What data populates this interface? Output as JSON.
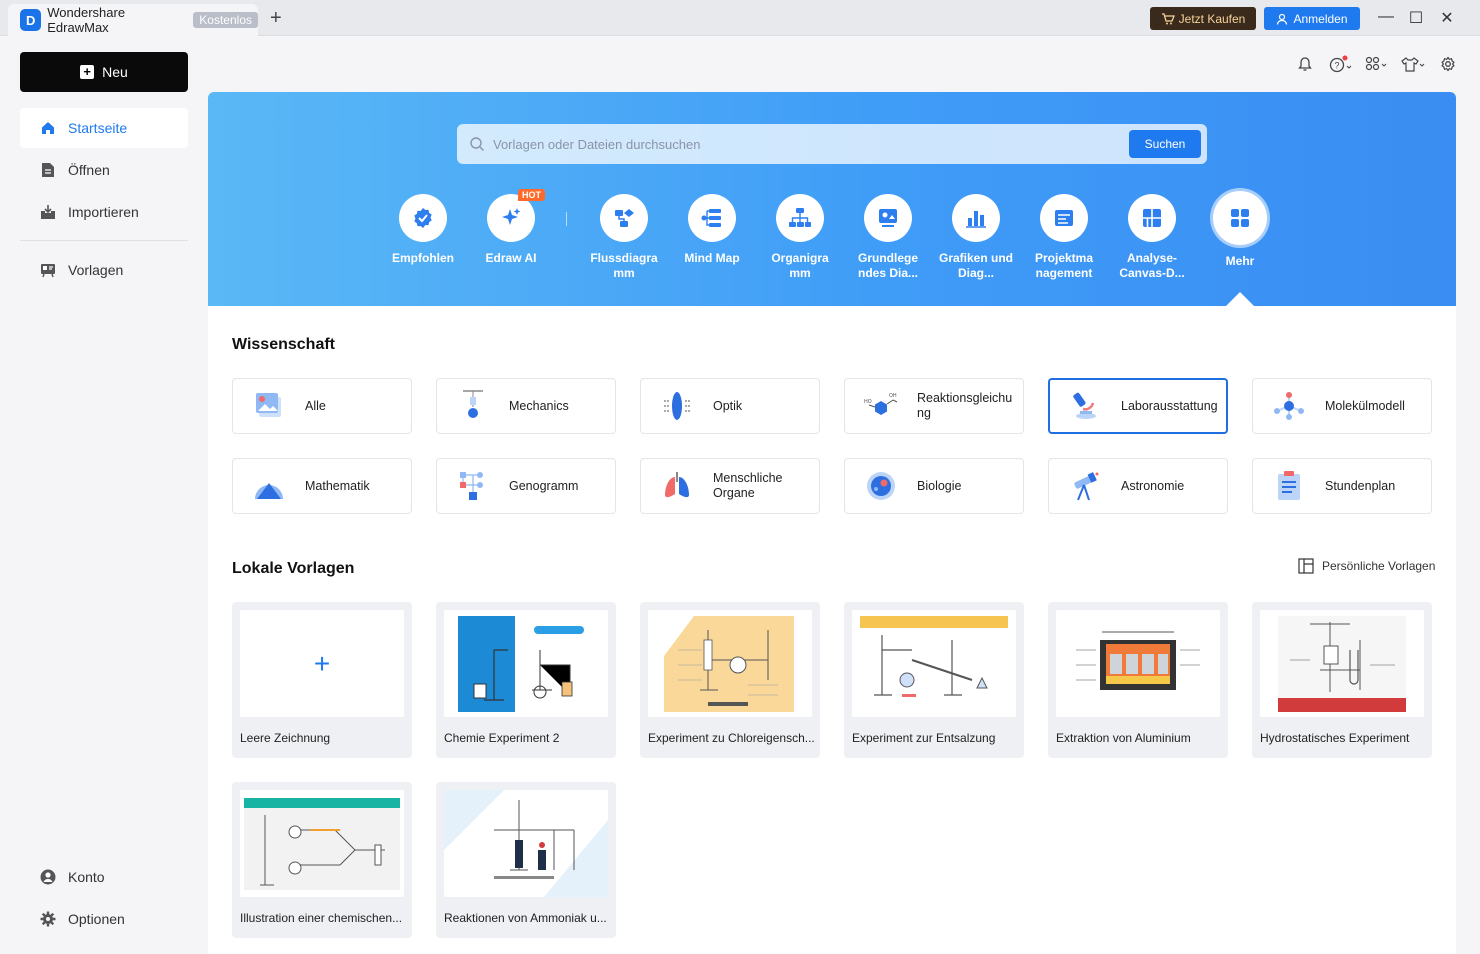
{
  "titlebar": {
    "app_title": "Wondershare EdrawMax",
    "plan_badge": "Kostenlos",
    "new_tab": "+",
    "buy_label": "Jetzt Kaufen",
    "login_label": "Anmelden",
    "minimize": "—",
    "maximize": "☐",
    "close": "✕"
  },
  "sidebar": {
    "new_label": "Neu",
    "items": [
      {
        "label": "Startseite",
        "icon": "home-icon",
        "active": true
      },
      {
        "label": "Öffnen",
        "icon": "file-icon"
      },
      {
        "label": "Importieren",
        "icon": "import-icon"
      },
      {
        "label": "Vorlagen",
        "icon": "templates-icon"
      }
    ],
    "bottom": [
      {
        "label": "Konto",
        "icon": "account-icon"
      },
      {
        "label": "Optionen",
        "icon": "gear-icon"
      }
    ]
  },
  "search": {
    "placeholder": "Vorlagen oder Dateien durchsuchen",
    "button": "Suchen"
  },
  "categories": [
    {
      "label": "Empfohlen",
      "icon": "recommended-icon"
    },
    {
      "label": "Edraw AI",
      "icon": "ai-sparkle-icon",
      "badge": "HOT"
    },
    {
      "label": "Flussdiagra mm",
      "icon": "flowchart-icon"
    },
    {
      "label": "Mind Map",
      "icon": "mindmap-icon"
    },
    {
      "label": "Organigra mm",
      "icon": "orgchart-icon"
    },
    {
      "label": "Grundlege ndes Dia...",
      "icon": "basic-diagram-icon"
    },
    {
      "label": "Grafiken und Diag...",
      "icon": "bar-chart-icon"
    },
    {
      "label": "Projektma nagement",
      "icon": "project-icon"
    },
    {
      "label": "Analyse-Canvas-D...",
      "icon": "canvas-icon"
    },
    {
      "label": "Mehr",
      "icon": "more-grid-icon",
      "active": true
    }
  ],
  "science": {
    "title": "Wissenschaft",
    "items": [
      {
        "label": "Alle"
      },
      {
        "label": "Mechanics"
      },
      {
        "label": "Optik"
      },
      {
        "label": "Reaktionsgleichu ng"
      },
      {
        "label": "Laborausstattung",
        "selected": true
      },
      {
        "label": "Molekülmodell"
      },
      {
        "label": "Mathematik"
      },
      {
        "label": "Genogramm"
      },
      {
        "label": "Menschliche Organe"
      },
      {
        "label": "Biologie"
      },
      {
        "label": "Astronomie"
      },
      {
        "label": "Stundenplan"
      }
    ]
  },
  "local": {
    "title": "Lokale Vorlagen",
    "personal_link": "Persönliche Vorlagen",
    "blank_plus": "+",
    "items": [
      {
        "label": "Leere Zeichnung"
      },
      {
        "label": "Chemie Experiment 2"
      },
      {
        "label": "Experiment zu Chloreigensch..."
      },
      {
        "label": "Experiment zur Entsalzung"
      },
      {
        "label": "Extraktion von Aluminium"
      },
      {
        "label": "Hydrostatisches Experiment"
      },
      {
        "label": "Illustration einer chemischen..."
      },
      {
        "label": "Reaktionen von Ammoniak u..."
      }
    ]
  },
  "colors": {
    "accent": "#1f7aef",
    "hero_start": "#5ab8f6",
    "hero_end": "#3a8df2",
    "buy_bg": "#3a2a1c"
  }
}
